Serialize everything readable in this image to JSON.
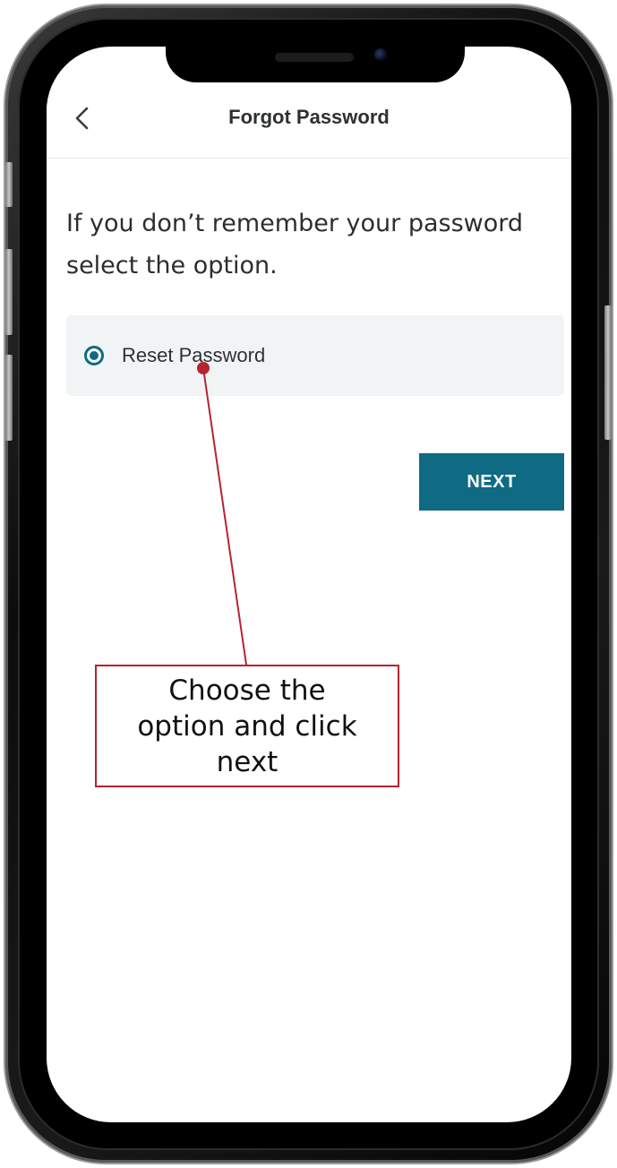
{
  "header": {
    "title": "Forgot Password",
    "back_icon": "chevron-left-icon"
  },
  "instruction": {
    "text": "If you don’t remember your password select the option."
  },
  "options": [
    {
      "label": "Reset Password",
      "selected": true
    }
  ],
  "actions": {
    "next_label": "NEXT"
  },
  "annotation": {
    "callout_text": "Choose the option and click next"
  },
  "colors": {
    "accent": "#0e6b83",
    "annotation": "#b5242f",
    "option_bg": "#f1f4f5",
    "text": "#2e3133"
  }
}
